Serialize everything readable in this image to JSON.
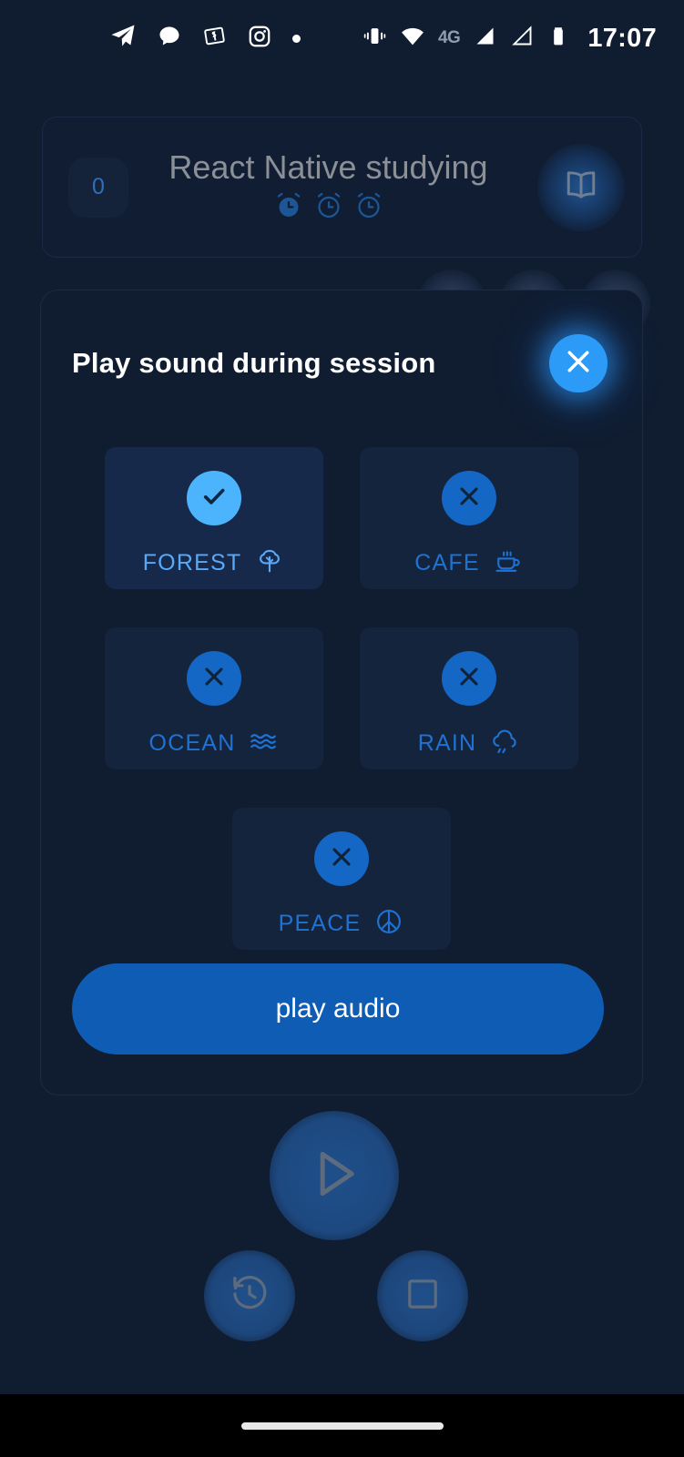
{
  "status_bar": {
    "time": "17:07",
    "network_label": "4G",
    "left_icons": [
      "telegram-icon",
      "chat-bubble-icon",
      "cash-note-icon",
      "instagram-icon",
      "dot-indicator-icon"
    ],
    "right_icons": [
      "vibrate-icon",
      "wifi-icon",
      "signal-bars-icon",
      "signal-empty-icon",
      "battery-icon"
    ]
  },
  "task_card": {
    "count": "0",
    "title": "React Native studying",
    "pomodoro_icons": [
      "alarm-clock-filled",
      "alarm-clock-outline",
      "alarm-clock-outline"
    ],
    "book_button_icon": "book-icon"
  },
  "modal": {
    "title": "Play sound during session",
    "close_icon": "close-icon",
    "sounds": [
      {
        "label": "FOREST",
        "icon": "tree-icon",
        "selected": true,
        "state_icon": "check-icon"
      },
      {
        "label": "CAFE",
        "icon": "coffee-cup-icon",
        "selected": false,
        "state_icon": "close-icon"
      },
      {
        "label": "OCEAN",
        "icon": "waves-icon",
        "selected": false,
        "state_icon": "close-icon"
      },
      {
        "label": "RAIN",
        "icon": "rain-cloud-icon",
        "selected": false,
        "state_icon": "close-icon"
      },
      {
        "label": "PEACE",
        "icon": "peace-icon",
        "selected": false,
        "state_icon": "close-icon"
      }
    ],
    "play_audio_label": "play audio"
  },
  "transport": {
    "play_icon": "play-icon",
    "history_icon": "history-icon",
    "stop_icon": "stop-icon"
  },
  "colors": {
    "background": "#101c30",
    "accent_bright": "#2b9bf7",
    "accent_button": "#0f5cb5",
    "card": "#14243d",
    "card_selected": "#16294a",
    "label_unselected": "#1f72d2",
    "label_selected": "#5aa9f8"
  }
}
